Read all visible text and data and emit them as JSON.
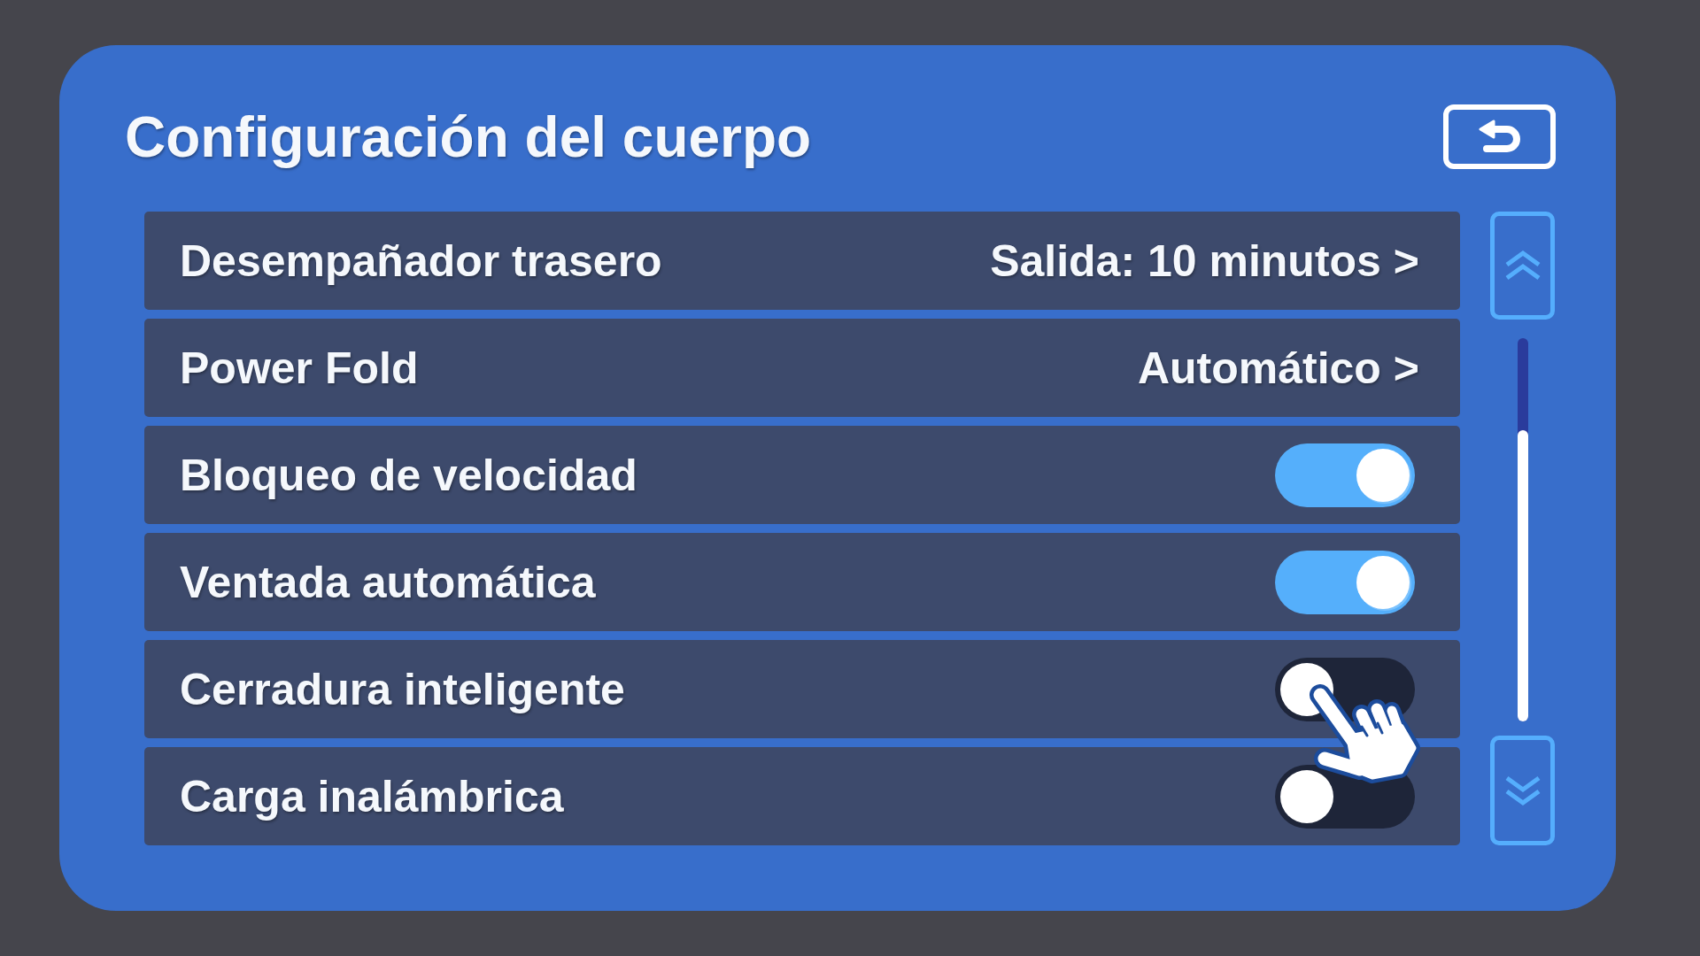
{
  "header": {
    "title": "Configuración del cuerpo"
  },
  "settings": [
    {
      "kind": "link",
      "label": "Desempañador trasero",
      "value": "Salida: 10 minutos >"
    },
    {
      "kind": "link",
      "label": "Power Fold",
      "value": "Automático >"
    },
    {
      "kind": "toggle",
      "label": "Bloqueo de velocidad",
      "on": true
    },
    {
      "kind": "toggle",
      "label": "Ventada automática",
      "on": true
    },
    {
      "kind": "toggle",
      "label": "Cerradura inteligente",
      "on": false
    },
    {
      "kind": "toggle",
      "label": "Carga inalámbrica",
      "on": false
    }
  ]
}
